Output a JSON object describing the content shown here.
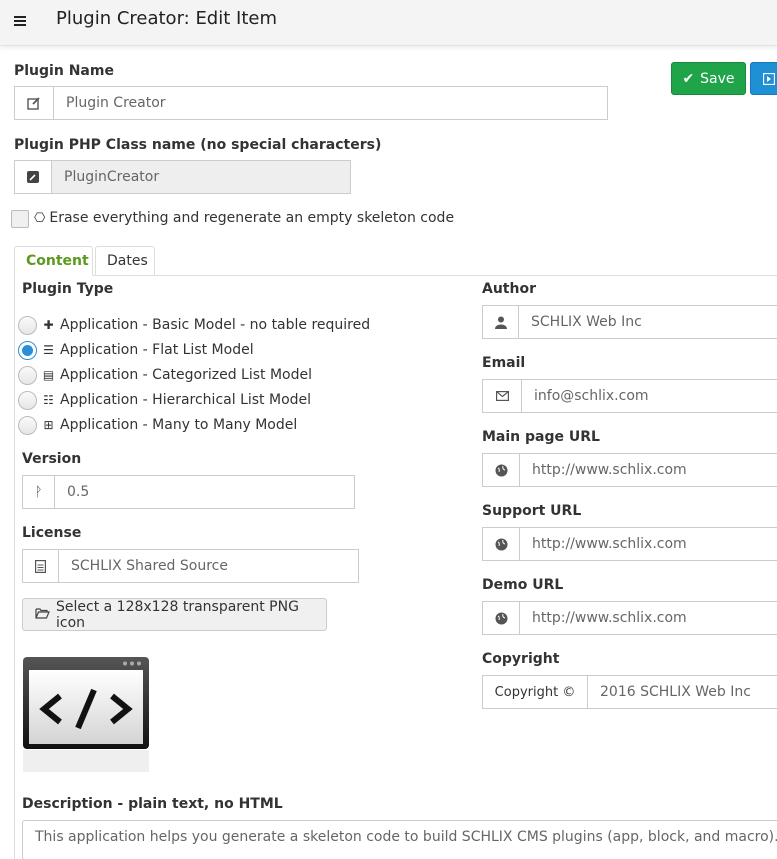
{
  "header": {
    "title": "Plugin Creator: Edit Item"
  },
  "toolbar": {
    "save_label": "Save"
  },
  "form": {
    "plugin_name": {
      "label": "Plugin Name",
      "value": "Plugin Creator"
    },
    "class_name": {
      "label": "Plugin PHP Class name (no special characters)",
      "value": "PluginCreator"
    },
    "erase_label": "Erase everything and regenerate an empty skeleton code"
  },
  "tabs": [
    {
      "label": "Content"
    },
    {
      "label": "Dates"
    }
  ],
  "plugin_type": {
    "label": "Plugin Type",
    "options": [
      {
        "label": "Application - Basic Model - no table required",
        "icon": "puzzle-icon",
        "checked": false
      },
      {
        "label": "Application - Flat List Model",
        "icon": "bars-icon",
        "checked": true
      },
      {
        "label": "Application - Categorized List Model",
        "icon": "list-alt-icon",
        "checked": false
      },
      {
        "label": "Application - Hierarchical List Model",
        "icon": "list-ul-icon",
        "checked": false
      },
      {
        "label": "Application - Many to Many Model",
        "icon": "table-icon",
        "checked": false
      }
    ]
  },
  "version": {
    "label": "Version",
    "value": "0.5"
  },
  "license": {
    "label": "License",
    "value": "SCHLIX Shared Source"
  },
  "icon_button": {
    "label": "Select a 128x128 transparent PNG icon"
  },
  "author": {
    "label": "Author",
    "value": "SCHLIX Web Inc"
  },
  "email": {
    "label": "Email",
    "value": "info@schlix.com"
  },
  "main_url": {
    "label": "Main page URL",
    "value": "http://www.schlix.com"
  },
  "support_url": {
    "label": "Support URL",
    "value": "http://www.schlix.com"
  },
  "demo_url": {
    "label": "Demo URL",
    "value": "http://www.schlix.com"
  },
  "copyright": {
    "label": "Copyright",
    "prefix": "Copyright ©",
    "value": "2016 SCHLIX Web Inc"
  },
  "description": {
    "label": "Description - plain text, no HTML",
    "value": "This application helps you generate a skeleton code to build SCHLIX CMS plugins (app, block, and macro)."
  },
  "colors": {
    "save": "#1fa44a",
    "accent": "#2a8fd8",
    "tab_active": "#5a9a1e"
  }
}
